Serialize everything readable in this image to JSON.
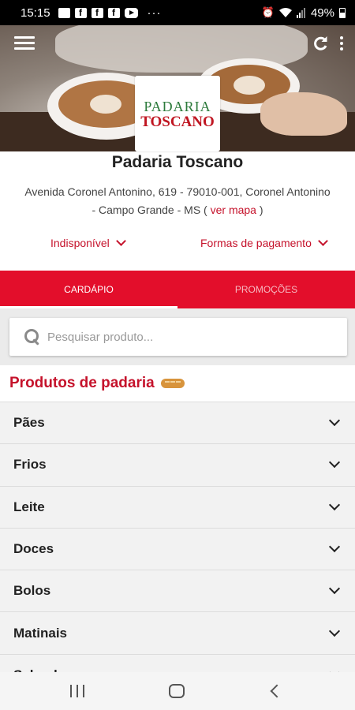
{
  "status_bar": {
    "time": "15:15",
    "dots": "···",
    "battery": "49%"
  },
  "store": {
    "name": "Padaria Toscano",
    "logo_top": "PADARIA",
    "logo_bottom": "TOSCANO",
    "address": "Avenida Coronel Antonino, 619 - 79010-001, Coronel Antonino - Campo Grande - MS (",
    "map_link": "ver mapa",
    "address_end": ")",
    "availability": "Indisponível",
    "payment_methods": "Formas de pagamento"
  },
  "tabs": [
    {
      "label": "CARDÁPIO",
      "active": true
    },
    {
      "label": "PROMOÇÕES",
      "active": false
    }
  ],
  "search": {
    "placeholder": "Pesquisar produto..."
  },
  "section": {
    "title": "Produtos de padaria",
    "icon": "bread-icon"
  },
  "categories": [
    {
      "label": "Pães"
    },
    {
      "label": "Frios"
    },
    {
      "label": "Leite"
    },
    {
      "label": "Doces"
    },
    {
      "label": "Bolos"
    },
    {
      "label": "Matinais"
    },
    {
      "label": "Salgados"
    }
  ],
  "colors": {
    "accent": "#e30e2b",
    "link": "#c5122b"
  }
}
